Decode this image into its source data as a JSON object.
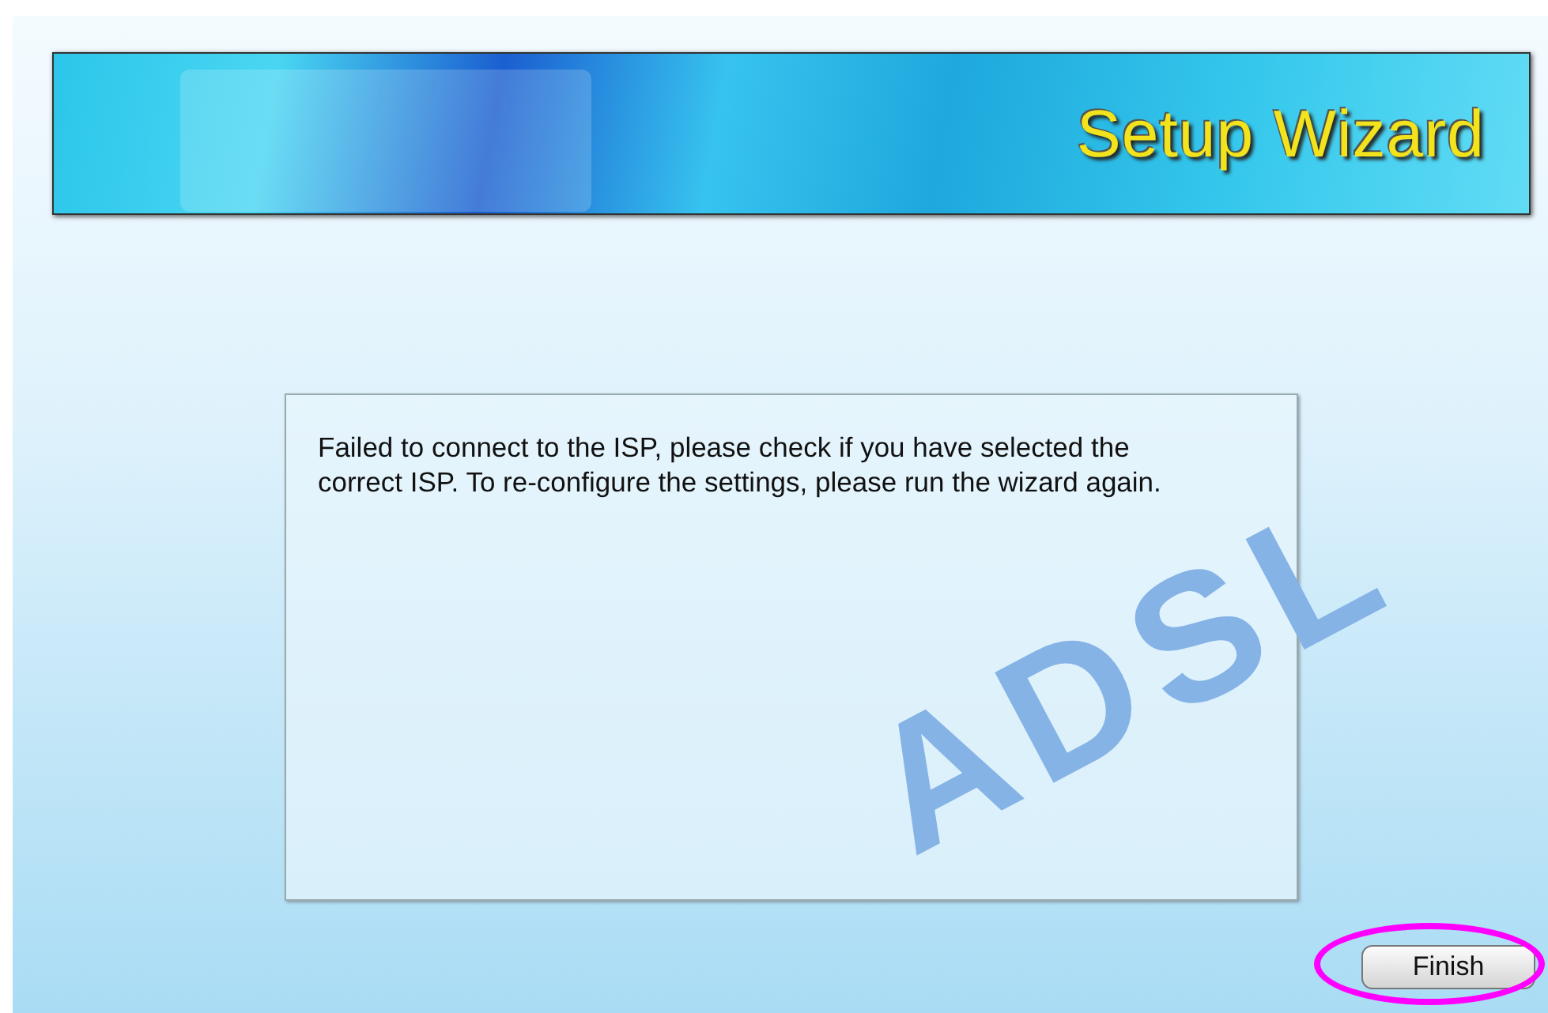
{
  "banner": {
    "title": "Setup Wizard"
  },
  "background_logo": "ADSL",
  "message": "Failed to connect to the ISP, please check if you have selected the correct ISP. To re-configure the settings, please run the wizard again.",
  "buttons": [
    {
      "label": "Finish",
      "highlighted": true
    }
  ]
}
